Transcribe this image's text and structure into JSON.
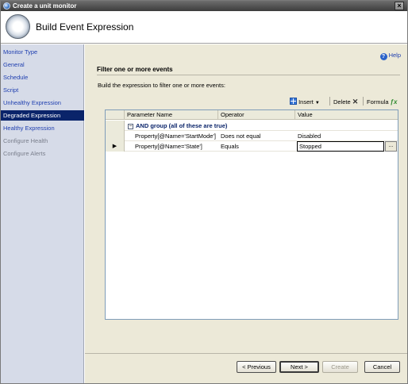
{
  "window": {
    "title": "Create a unit monitor"
  },
  "header": {
    "title": "Build Event Expression"
  },
  "sidebar": {
    "items": [
      {
        "label": "Monitor Type",
        "state": "link"
      },
      {
        "label": "General",
        "state": "link"
      },
      {
        "label": "Schedule",
        "state": "link"
      },
      {
        "label": "Script",
        "state": "link"
      },
      {
        "label": "Unhealthy Expression",
        "state": "link"
      },
      {
        "label": "Degraded Expression",
        "state": "active"
      },
      {
        "label": "Healthy Expression",
        "state": "link"
      },
      {
        "label": "Configure Health",
        "state": "disabled"
      },
      {
        "label": "Configure Alerts",
        "state": "disabled"
      }
    ]
  },
  "main": {
    "help_label": "Help",
    "section_title": "Filter one or more events",
    "description": "Build the expression to filter one or more events:",
    "toolbar": {
      "insert_label": "Insert",
      "delete_label": "Delete",
      "formula_label": "Formula"
    },
    "grid": {
      "columns": [
        "Parameter Name",
        "Operator",
        "Value"
      ],
      "group_label": "AND group (all of these are true)",
      "rows": [
        {
          "parameter": "Property[@Name='StartMode']",
          "operator": "Does not equal",
          "value": "Disabled"
        },
        {
          "parameter": "Property[@Name='State']",
          "operator": "Equals",
          "value": "Stopped"
        }
      ],
      "row_indicator": "▶",
      "ellipsis": "..."
    }
  },
  "footer": {
    "previous_label": "< Previous",
    "next_label": "Next >",
    "create_label": "Create",
    "cancel_label": "Cancel"
  },
  "colors": {
    "accent": "#0a246a",
    "link": "#1f3fb0",
    "sidebar_bg": "#d6dbe8",
    "panel_bg": "#ece9d8"
  }
}
